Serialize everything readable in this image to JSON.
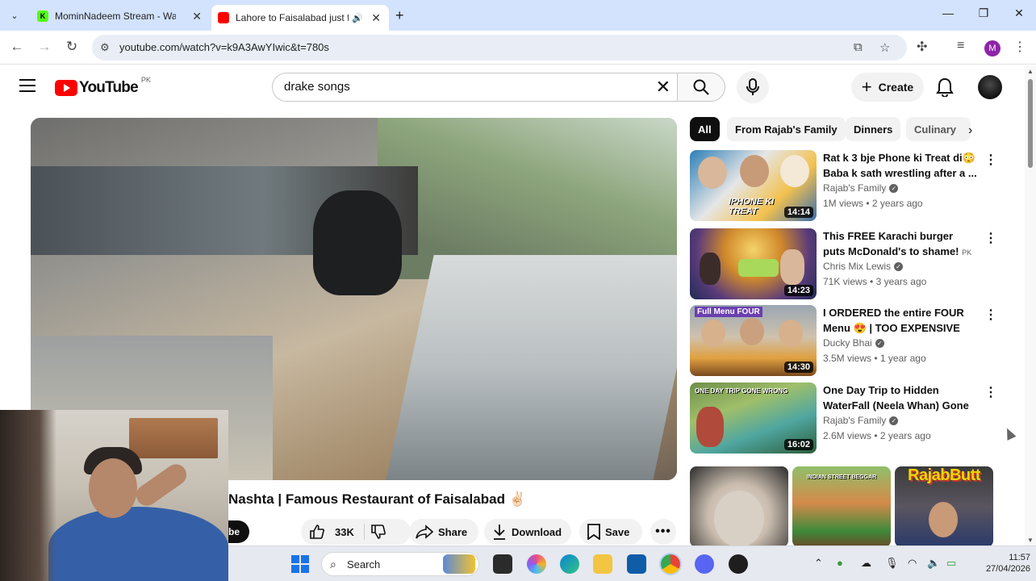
{
  "browser": {
    "tabs": [
      {
        "title": "MominNadeem Stream - Watch",
        "favicon": "kick-icon",
        "color": "#53fc18"
      },
      {
        "title": "Lahore to Faisalabad just fo",
        "favicon": "youtube-icon",
        "color": "#ff0000"
      }
    ],
    "url": "youtube.com/watch?v=k9A3AwYIwic&t=780s",
    "profile_initial": "M"
  },
  "youtube": {
    "logo_word": "YouTube",
    "country_code": "PK",
    "search_value": "drake songs",
    "create_label": "Create"
  },
  "video": {
    "title": "Nashta | Famous Restaurant of Faisalabad ✌🏻",
    "subscribe_partial": "be",
    "likes": "33K",
    "share_label": "Share",
    "download_label": "Download",
    "save_label": "Save"
  },
  "chips": [
    "All",
    "From Rajab's Family",
    "Dinners",
    "Culinary"
  ],
  "recommendations": [
    {
      "title": "Rat k 3 bje Phone ki Treat di😳 Baba k sath wrestling after a ...",
      "channel": "Rajab's Family",
      "verified": true,
      "views": "1M views",
      "age": "2 years ago",
      "duration": "14:14",
      "thumb_text": "IPHONE KI TREAT"
    },
    {
      "title": "This FREE Karachi burger puts McDonald's to shame!",
      "title_suffix": "PK",
      "channel": "Chris Mix Lewis",
      "verified": true,
      "views": "71K views",
      "age": "3 years ago",
      "duration": "14:23",
      "thumb_text": ""
    },
    {
      "title": "I ORDERED the entire FOUR Menu 😍 | TOO EXPENSIVE Or...",
      "channel": "Ducky Bhai",
      "verified": true,
      "views": "3.5M views",
      "age": "1 year ago",
      "duration": "14:30",
      "thumb_text": "Full Menu FOUR"
    },
    {
      "title": "One Day Trip to Hidden WaterFall (Neela Whan) Gone ...",
      "channel": "Rajab's Family",
      "verified": true,
      "views": "2.6M views",
      "age": "2 years ago",
      "duration": "16:02",
      "thumb_text": "ONE DAY TRIP GONE WRONG"
    }
  ],
  "shorts": [
    {
      "thumb_text": ""
    },
    {
      "thumb_text": "INDIAN STREET BEGGAR"
    },
    {
      "thumb_text": "RajabButt"
    }
  ],
  "taskbar": {
    "search_label": "Search",
    "time": "11:57",
    "date": "27/04/2026"
  }
}
